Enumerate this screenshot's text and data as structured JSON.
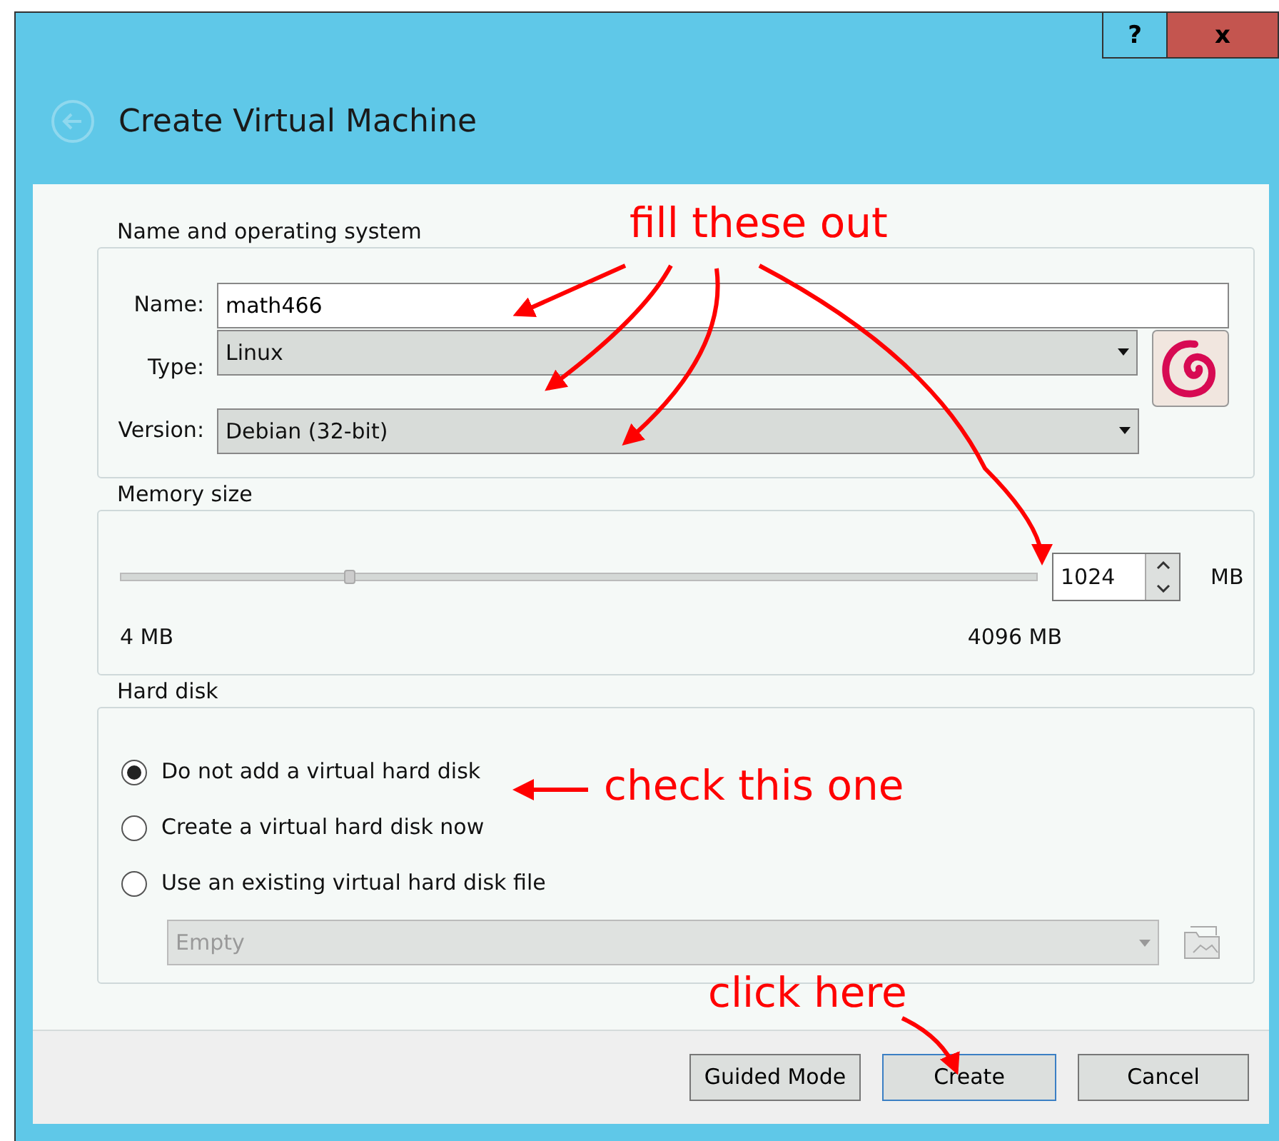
{
  "window": {
    "title": "Create Virtual Machine",
    "buttons": [
      {
        "label": "?",
        "kind": "help"
      },
      {
        "label": "x",
        "kind": "close"
      }
    ]
  },
  "name_group": {
    "title": "Name and operating system",
    "fields": [
      {
        "label": "Name:",
        "value": "math466",
        "kind": "text"
      },
      {
        "label": "Type:",
        "value": "Linux",
        "kind": "combo"
      },
      {
        "label": "Version:",
        "value": "Debian (32-bit)",
        "kind": "combo"
      }
    ]
  },
  "memory": {
    "title": "Memory size",
    "level": 0.25,
    "value": "1024",
    "unit": "MB",
    "min_label": "4 MB",
    "max_label": "4096 MB"
  },
  "hard_disk": {
    "title": "Hard disk",
    "options": [
      {
        "label": "Do not add a virtual hard disk",
        "selected": true
      },
      {
        "label": "Create a virtual hard disk now",
        "selected": false
      },
      {
        "label": "Use an existing virtual hard disk file",
        "selected": false
      }
    ],
    "file_combo": {
      "value": "Empty",
      "disabled": true
    }
  },
  "buttons": [
    {
      "label": "Guided Mode",
      "default": false
    },
    {
      "label": "Create",
      "default": true
    },
    {
      "label": "Cancel",
      "default": false
    }
  ],
  "annotations": [
    {
      "text": "fill these out",
      "kind": "fill"
    },
    {
      "text": "check this one",
      "kind": "check"
    },
    {
      "text": "click here",
      "kind": "click"
    }
  ]
}
